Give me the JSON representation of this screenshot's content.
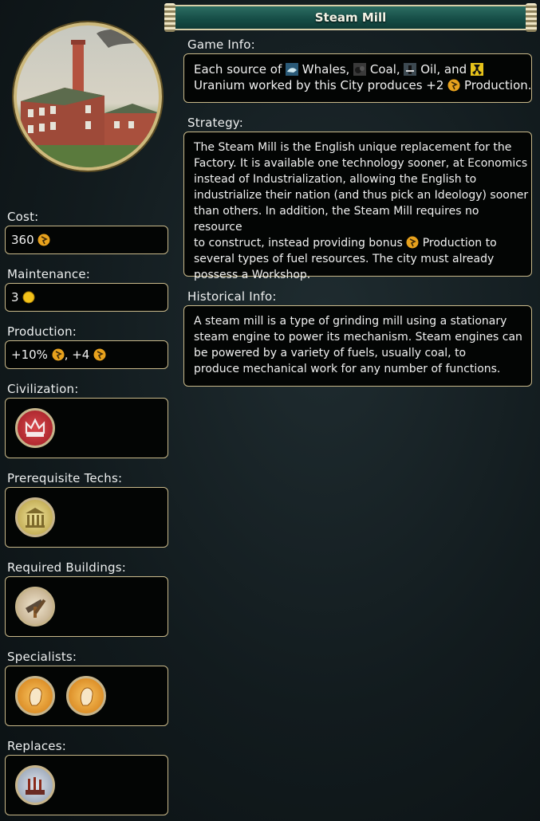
{
  "title": "Steam Mill",
  "left": {
    "cost_label": "Cost:",
    "cost_value": "360",
    "maintenance_label": "Maintenance:",
    "maintenance_value": "3",
    "production_label": "Production:",
    "production_pct": "+10%",
    "production_sep": ", +4",
    "civilization_label": "Civilization:",
    "prereq_label": "Prerequisite Techs:",
    "required_label": "Required Buildings:",
    "specialists_label": "Specialists:",
    "replaces_label": "Replaces:"
  },
  "game_info": {
    "label": "Game Info:",
    "t1": "Each source of",
    "t2": "Whales,",
    "t3": "Coal,",
    "t4": "Oil, and",
    "t5": "Uranium worked by this City produces +2",
    "t6": "Production."
  },
  "strategy": {
    "label": "Strategy:",
    "lines": [
      "The Steam Mill is the English unique replacement for the",
      "Factory. It is available one technology sooner, at Economics",
      "instead of Industrialization, allowing the English to",
      "industrialize their nation (and thus pick an Ideology) sooner",
      "than others. In addition, the Steam Mill requires no resource",
      "to construct, instead providing bonus",
      "Production to",
      "several types of fuel resources. The city must already",
      "possess a Workshop."
    ]
  },
  "historical": {
    "label": "Historical Info:",
    "lines": [
      "A steam mill is a type of grinding mill using a stationary",
      "steam engine to power its mechanism. Steam engines can",
      "be powered by a variety of fuels, usually coal, to",
      "produce mechanical work for any number of functions."
    ]
  },
  "colors": {
    "border": "#c9b98a",
    "title_bg": "#154c45",
    "box_bg": "#030504",
    "production_icon": "#e8a21d",
    "gold_icon": "#f3c21a"
  },
  "icons": [
    "production-icon",
    "gold-icon",
    "whales-icon",
    "coal-icon",
    "oil-icon",
    "uranium-icon",
    "england-crown-icon",
    "economics-tech-icon",
    "workshop-icon",
    "great-engineer-icon",
    "factory-icon"
  ]
}
